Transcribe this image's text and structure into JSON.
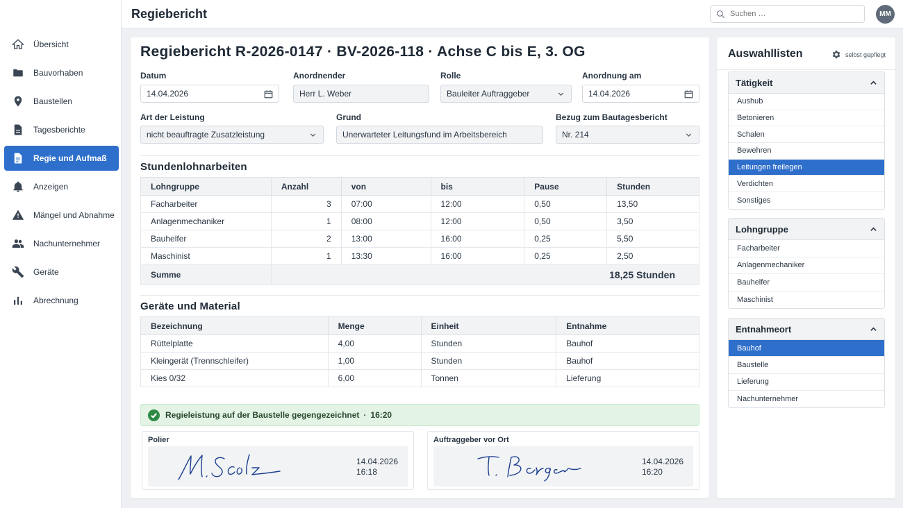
{
  "app": {
    "title": "Regiebericht"
  },
  "search": {
    "placeholder": "Suchen …"
  },
  "user": {
    "initials": "MM"
  },
  "sidebar": {
    "items": [
      {
        "label": "Übersicht",
        "icon": "home-icon"
      },
      {
        "label": "Bauvorhaben",
        "icon": "folder-icon"
      },
      {
        "label": "Baustellen",
        "icon": "location-pin-icon"
      },
      {
        "label": "Tagesberichte",
        "icon": "document-icon"
      },
      {
        "label": "Regie und Aufmaß",
        "icon": "document-list-icon",
        "active": true
      },
      {
        "label": "Anzeigen",
        "icon": "bell-icon"
      },
      {
        "label": "Mängel und Abnahme",
        "icon": "warning-icon"
      },
      {
        "label": "Nachunternehmer",
        "icon": "people-icon"
      },
      {
        "label": "Geräte",
        "icon": "wrench-icon"
      },
      {
        "label": "Abrechnung",
        "icon": "bar-chart-icon"
      }
    ]
  },
  "main": {
    "title": "Regiebericht R-2026-0147 · BV-2026-118 · Achse C bis E, 3. OG",
    "form": {
      "datum_label": "Datum",
      "datum_value": "14.04.2026",
      "anordnender_label": "Anordnender",
      "anordnender_value": "Herr L. Weber",
      "rolle_label": "Rolle",
      "rolle_value": "Bauleiter Auftraggeber",
      "anordnung_label": "Anordnung am",
      "anordnung_value": "14.04.2026",
      "art_label": "Art der Leistung",
      "art_value": "nicht beauftragte Zusatzleistung",
      "grund_label": "Grund",
      "grund_value": "Unerwarteter Leitungsfund im Arbeitsbereich",
      "bezug_label": "Bezug zum Bautagesbericht",
      "bezug_value": "Nr. 214"
    },
    "stunden": {
      "title": "Stundenlohnarbeiten",
      "headers": [
        "Lohngruppe",
        "Anzahl",
        "von",
        "bis",
        "Pause",
        "Stunden"
      ],
      "rows": [
        [
          "Facharbeiter",
          "3",
          "07:00",
          "12:00",
          "0,50",
          "13,50"
        ],
        [
          "Anlagenmechaniker",
          "1",
          "08:00",
          "12:00",
          "0,50",
          "3,50"
        ],
        [
          "Bauhelfer",
          "2",
          "13:00",
          "16:00",
          "0,25",
          "5,50"
        ],
        [
          "Maschinist",
          "1",
          "13:30",
          "16:00",
          "0,25",
          "2,50"
        ]
      ],
      "sum_label": "Summe",
      "sum_value": "18,25 Stunden"
    },
    "geraete": {
      "title": "Geräte und Material",
      "headers": [
        "Bezeichnung",
        "Menge",
        "Einheit",
        "Entnahme"
      ],
      "rows": [
        [
          "Rüttelplatte",
          "4,00",
          "Stunden",
          "Bauhof"
        ],
        [
          "Kleingerät (Trennschleifer)",
          "1,00",
          "Stunden",
          "Bauhof"
        ],
        [
          "Kies 0/32",
          "6,00",
          "Tonnen",
          "Lieferung"
        ]
      ]
    },
    "confirmation": {
      "text": "Regieleistung auf der Baustelle gegengezeichnet",
      "separator": "·",
      "time": "16:20",
      "status_color": "#2e8b45"
    },
    "signatures": [
      {
        "label": "Polier",
        "signature": "M. Scholz",
        "date": "14.04.2026",
        "time": "16:18"
      },
      {
        "label": "Auftraggeber vor Ort",
        "signature": "T. Berger",
        "date": "14.04.2026",
        "time": "16:20"
      }
    ]
  },
  "panel": {
    "title": "Auswahllisten",
    "meta": "selbst gepflegt",
    "groups": [
      {
        "title": "Tätigkeit",
        "items": [
          "Aushub",
          "Betonieren",
          "Schalen",
          "Bewehren",
          "Leitungen freilegen",
          "Verdichten",
          "Sonstiges"
        ],
        "selected": "Leitungen freilegen"
      },
      {
        "title": "Lohngruppe",
        "items": [
          "Facharbeiter",
          "Anlagenmechaniker",
          "Bauhelfer",
          "Maschinist"
        ],
        "selected": null
      },
      {
        "title": "Entnahmeort",
        "items": [
          "Bauhof",
          "Baustelle",
          "Lieferung",
          "Nachunternehmer"
        ],
        "selected": "Bauhof"
      }
    ]
  },
  "colors": {
    "accent": "#2f6fcc",
    "success_bg": "#e3f4e6",
    "signature_ink": "#1d3f8f"
  }
}
